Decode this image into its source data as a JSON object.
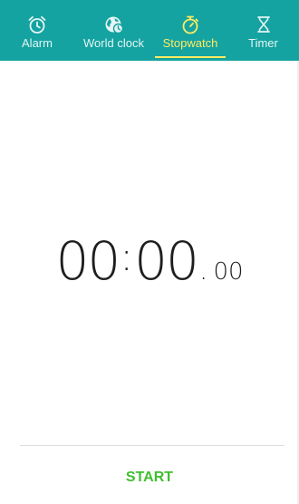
{
  "tabs": [
    {
      "id": "alarm",
      "label": "Alarm",
      "icon": "alarm-clock-icon",
      "active": false
    },
    {
      "id": "world",
      "label": "World clock",
      "icon": "globe-clock-icon",
      "active": false
    },
    {
      "id": "stopwatch",
      "label": "Stopwatch",
      "icon": "stopwatch-icon",
      "active": true
    },
    {
      "id": "timer",
      "label": "Timer",
      "icon": "hourglass-icon",
      "active": false
    }
  ],
  "stopwatch": {
    "minutes": "00",
    "colon": ":",
    "seconds": "00",
    "dot": ".",
    "hundredths": "00"
  },
  "start_button": {
    "label": "START"
  },
  "colors": {
    "tab_bar": "#14a3a0",
    "active_tab": "#ffeb63",
    "start": "#3fbf2e"
  }
}
